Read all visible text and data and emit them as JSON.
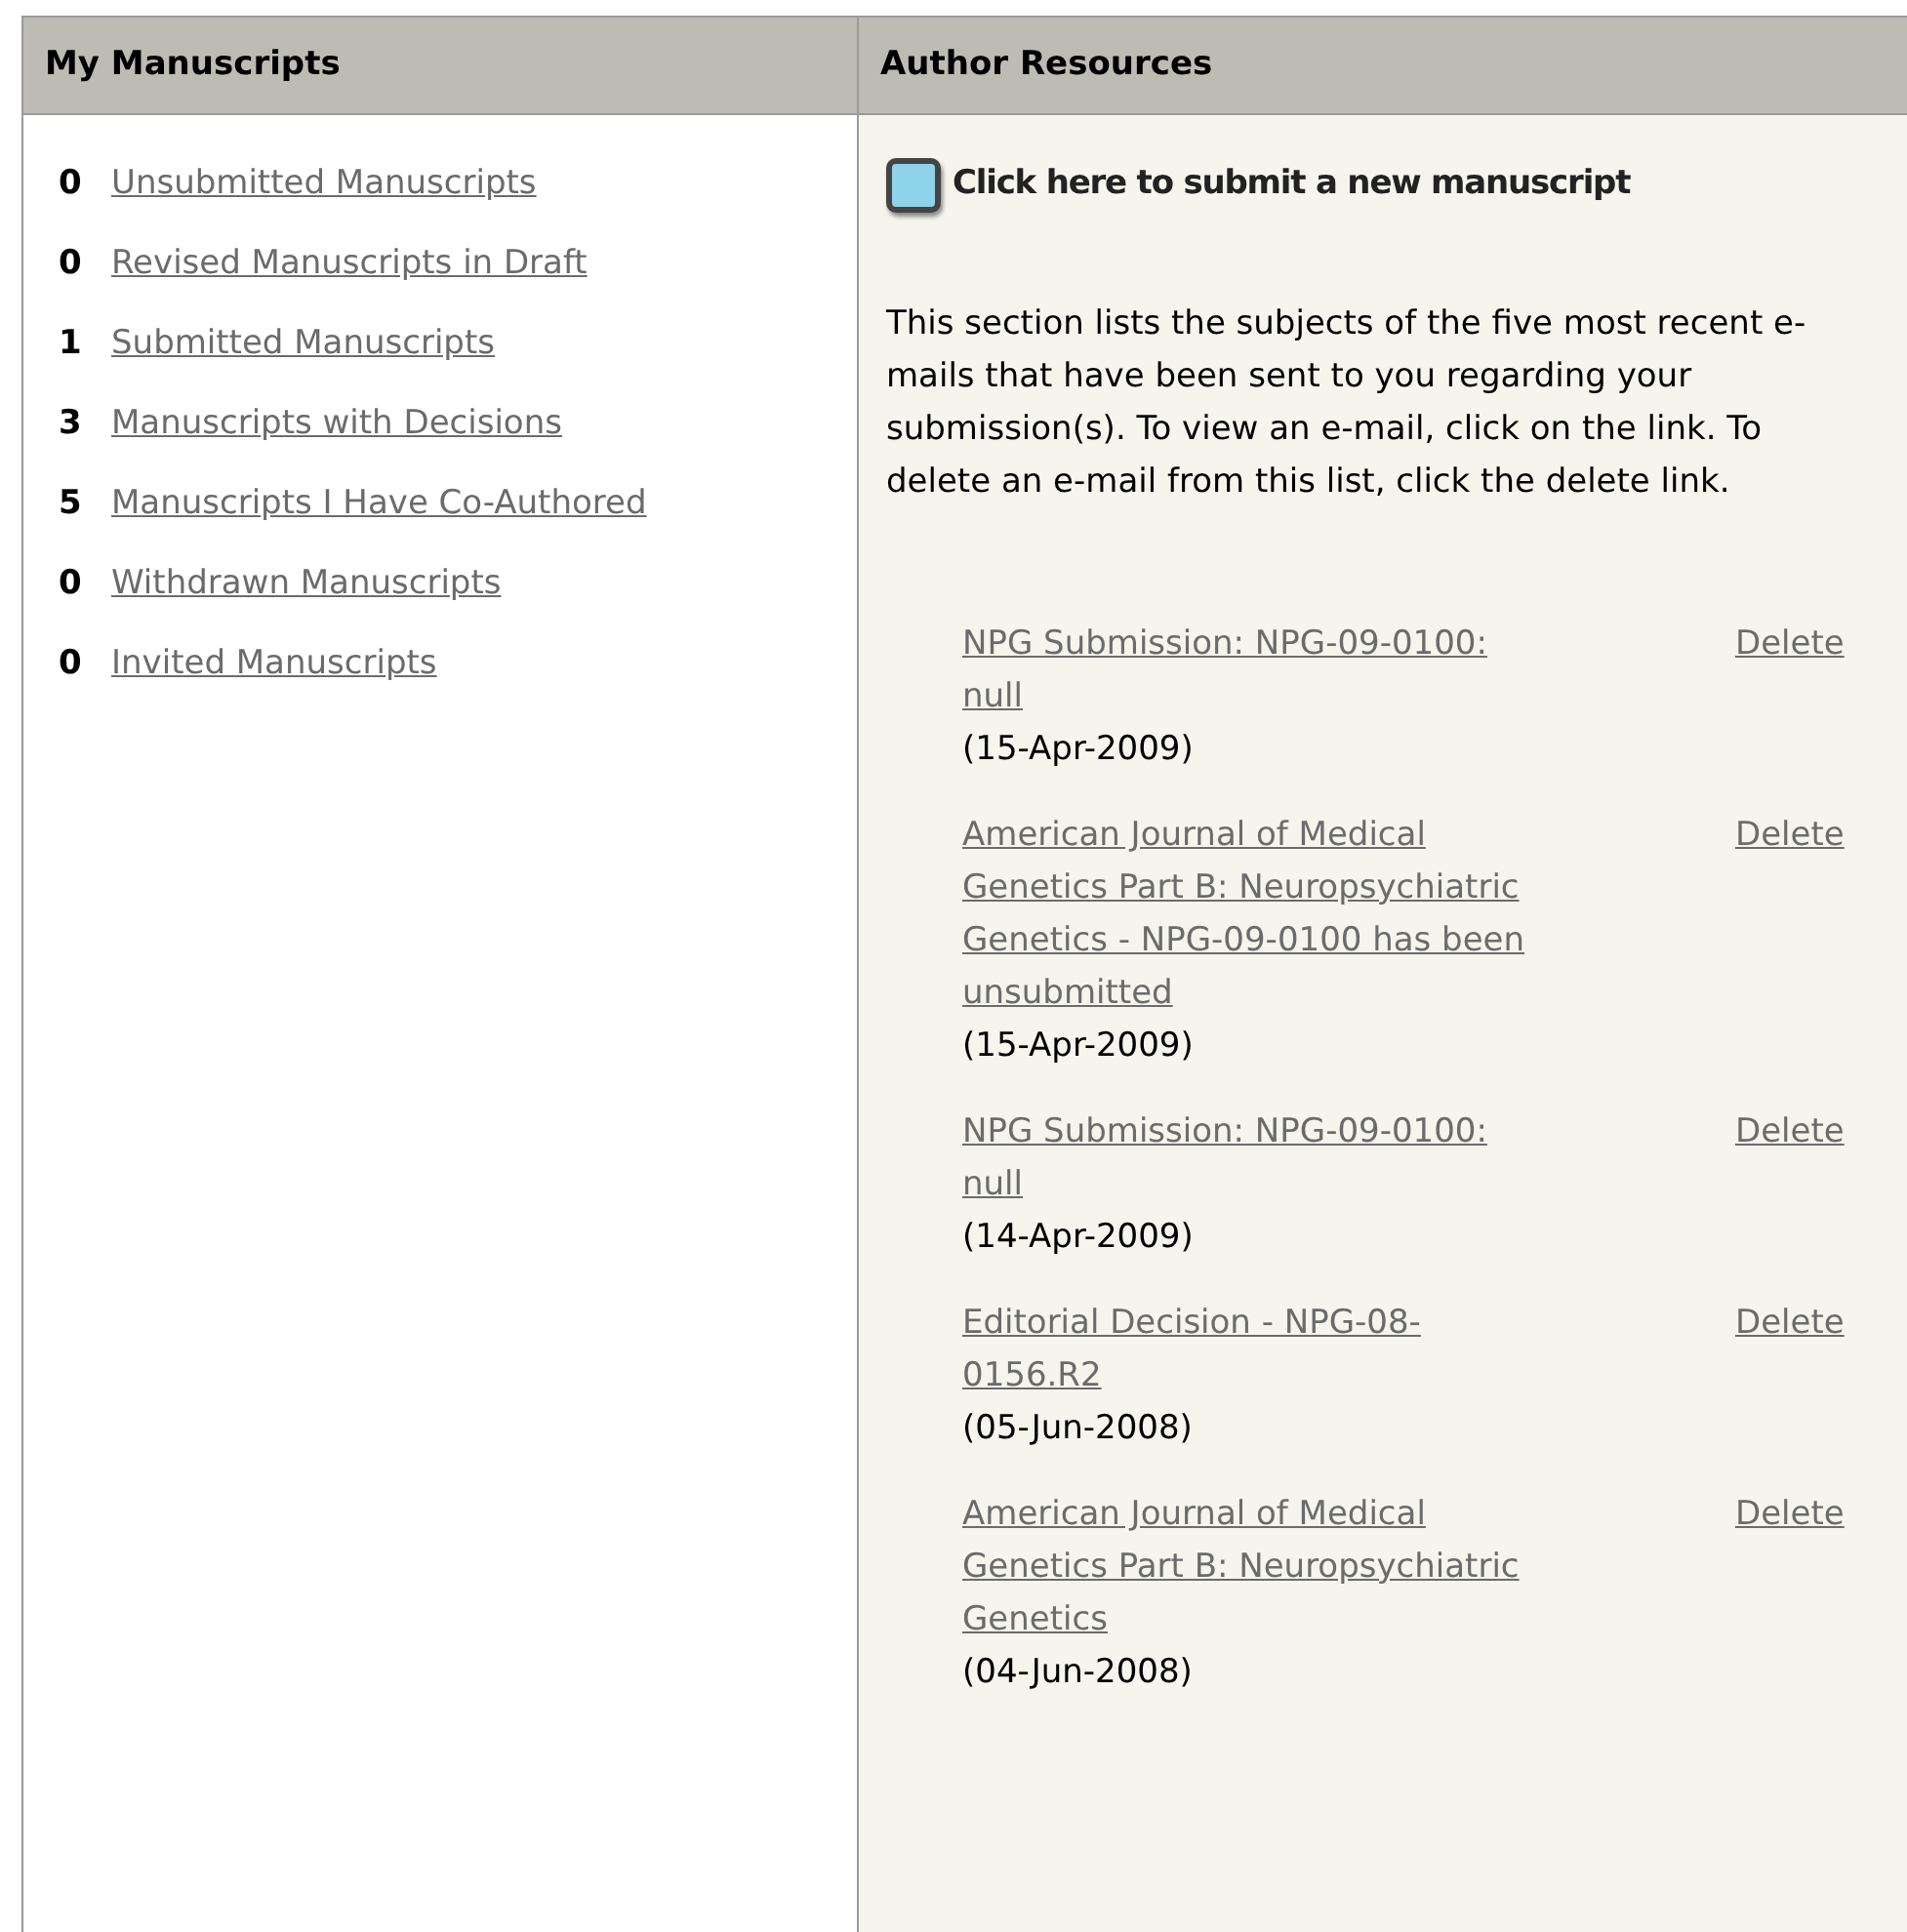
{
  "columns": [
    {
      "heading": "My Manuscripts"
    },
    {
      "heading": "Author Resources"
    }
  ],
  "manuscripts": [
    {
      "count": "0",
      "label": "Unsubmitted Manuscripts"
    },
    {
      "count": "0",
      "label": "Revised Manuscripts in Draft"
    },
    {
      "count": "1",
      "label": "Submitted Manuscripts"
    },
    {
      "count": "3",
      "label": "Manuscripts with Decisions"
    },
    {
      "count": "5",
      "label": "Manuscripts I Have Co-Authored"
    },
    {
      "count": "0",
      "label": "Withdrawn Manuscripts"
    },
    {
      "count": "0",
      "label": "Invited Manuscripts"
    }
  ],
  "submit_button": {
    "label": "Click here to submit a new manuscript"
  },
  "description": "This section lists the subjects of the five most recent e-mails that have been sent to you regarding your submission(s). To view an e-mail, click on the link. To delete an e-mail from this list, click the delete link.",
  "emails": [
    {
      "subject": "NPG Submission: NPG-09-0100: null",
      "date": "(15-Apr-2009)",
      "action": "Delete"
    },
    {
      "subject": "American Journal of Medical Genetics Part B: Neuropsychiatric Genetics - NPG-09-0100 has been unsubmitted",
      "date": "(15-Apr-2009)",
      "action": "Delete"
    },
    {
      "subject": "NPG Submission: NPG-09-0100: null",
      "date": "(14-Apr-2009)",
      "action": "Delete"
    },
    {
      "subject": "Editorial Decision - NPG-08-0156.R2",
      "date": "(05-Jun-2008)",
      "action": "Delete"
    },
    {
      "subject": "American Journal of Medical Genetics Part B: Neuropsychiatric Genetics",
      "date": "(04-Jun-2008)",
      "action": "Delete"
    }
  ]
}
